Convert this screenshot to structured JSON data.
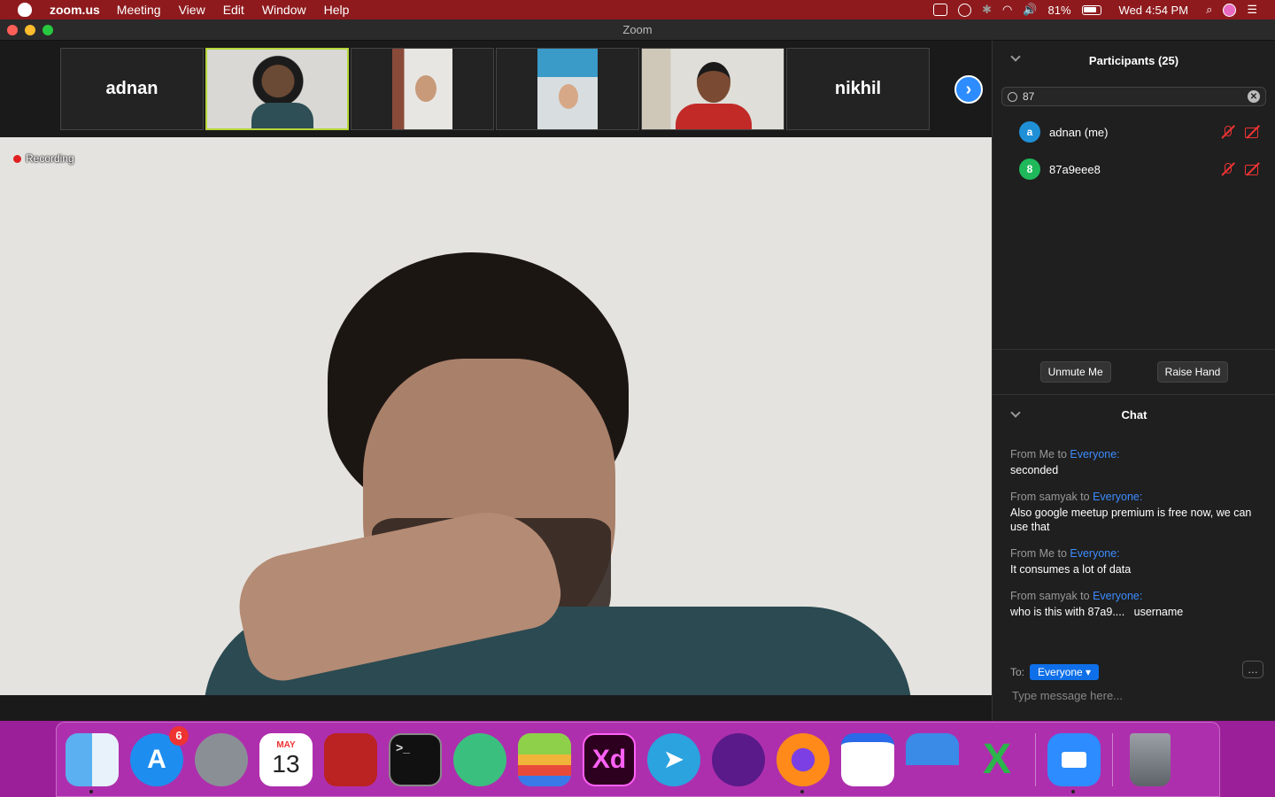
{
  "menubar": {
    "app_name": "zoom.us",
    "menus": [
      "Meeting",
      "View",
      "Edit",
      "Window",
      "Help"
    ],
    "battery": "81%",
    "clock": "Wed 4:54 PM"
  },
  "window": {
    "title": "Zoom"
  },
  "thumbnails": [
    {
      "name": "adnan",
      "type": "name"
    },
    {
      "name": "",
      "type": "video",
      "active": true
    },
    {
      "name": "",
      "type": "video"
    },
    {
      "name": "",
      "type": "video"
    },
    {
      "name": "",
      "type": "video"
    },
    {
      "name": "nikhil",
      "type": "name"
    }
  ],
  "recording": {
    "label": "Recording"
  },
  "participants": {
    "title": "Participants (25)",
    "search_value": "87",
    "list": [
      {
        "initial": "a",
        "name": "adnan (me)",
        "color": "#1f8fd6"
      },
      {
        "initial": "8",
        "name": "87a9eee8",
        "color": "#1fb85a"
      }
    ]
  },
  "buttons": {
    "unmute": "Unmute Me",
    "raise_hand": "Raise Hand"
  },
  "chat": {
    "title": "Chat",
    "messages": [
      {
        "from": "From Me to ",
        "to": "Everyone:",
        "body": "seconded"
      },
      {
        "from": "From samyak to ",
        "to": "Everyone:",
        "body": "Also google meetup premium is free now, we can use that"
      },
      {
        "from": "From Me to ",
        "to": "Everyone:",
        "body": "It consumes a lot of data"
      },
      {
        "from": "From samyak to ",
        "to": "Everyone:",
        "body": "who is this with 87a9....   username"
      }
    ],
    "to_label": "To:",
    "recipient": "Everyone",
    "more": "…",
    "placeholder": "Type message here..."
  },
  "dock": {
    "appstore_badge": "6",
    "calendar_month": "MAY",
    "calendar_day": "13",
    "xd_label": "Xd"
  }
}
